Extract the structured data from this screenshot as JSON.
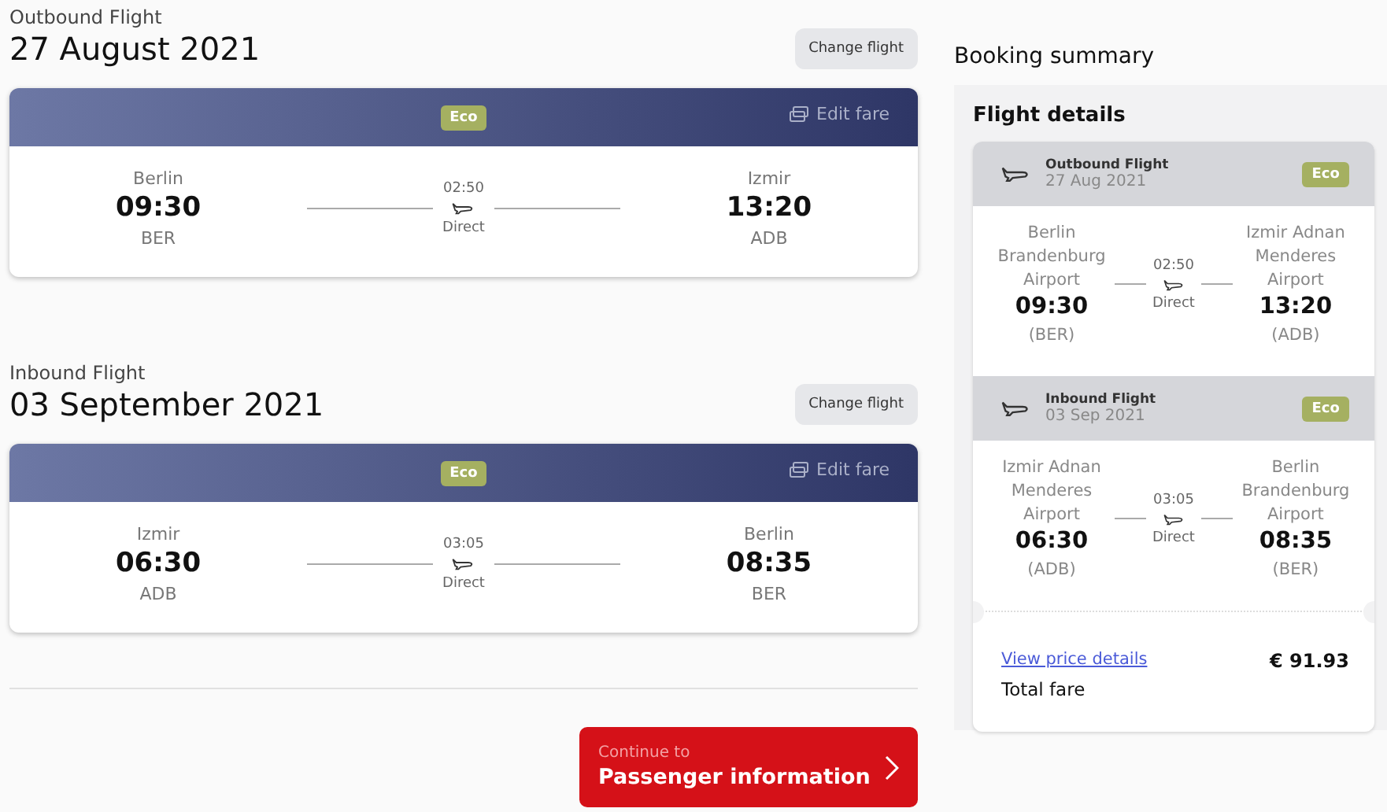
{
  "flights": [
    {
      "label": "Outbound Flight",
      "date": "27 August 2021",
      "change_button": "Change flight",
      "fare_class": "Eco",
      "edit_fare": "Edit fare",
      "origin": {
        "city": "Berlin",
        "time": "09:30",
        "code": "BER"
      },
      "duration": "02:50",
      "stops": "Direct",
      "destination": {
        "city": "Izmir",
        "time": "13:20",
        "code": "ADB"
      }
    },
    {
      "label": "Inbound Flight",
      "date": "03 September 2021",
      "change_button": "Change flight",
      "fare_class": "Eco",
      "edit_fare": "Edit fare",
      "origin": {
        "city": "Izmir",
        "time": "06:30",
        "code": "ADB"
      },
      "duration": "03:05",
      "stops": "Direct",
      "destination": {
        "city": "Berlin",
        "time": "08:35",
        "code": "BER"
      }
    }
  ],
  "continue_button": {
    "caption": "Continue to",
    "label": "Passenger information"
  },
  "summary": {
    "title": "Booking summary",
    "subtitle": "Flight details",
    "segments": [
      {
        "label": "Outbound Flight",
        "date": "27 Aug 2021",
        "fare_class": "Eco",
        "origin": {
          "airport": "Berlin Brandenburg Airport",
          "time": "09:30",
          "code": "(BER)"
        },
        "duration": "02:50",
        "stops": "Direct",
        "destination": {
          "airport": "Izmir Adnan Menderes Airport",
          "time": "13:20",
          "code": "(ADB)"
        }
      },
      {
        "label": "Inbound Flight",
        "date": "03 Sep 2021",
        "fare_class": "Eco",
        "origin": {
          "airport": "Izmir Adnan Menderes Airport",
          "time": "06:30",
          "code": "(ADB)"
        },
        "duration": "03:05",
        "stops": "Direct",
        "destination": {
          "airport": "Berlin Brandenburg Airport",
          "time": "08:35",
          "code": "(BER)"
        }
      }
    ],
    "price_link": "View price details",
    "total_label": "Total fare",
    "total": "€ 91.93"
  }
}
